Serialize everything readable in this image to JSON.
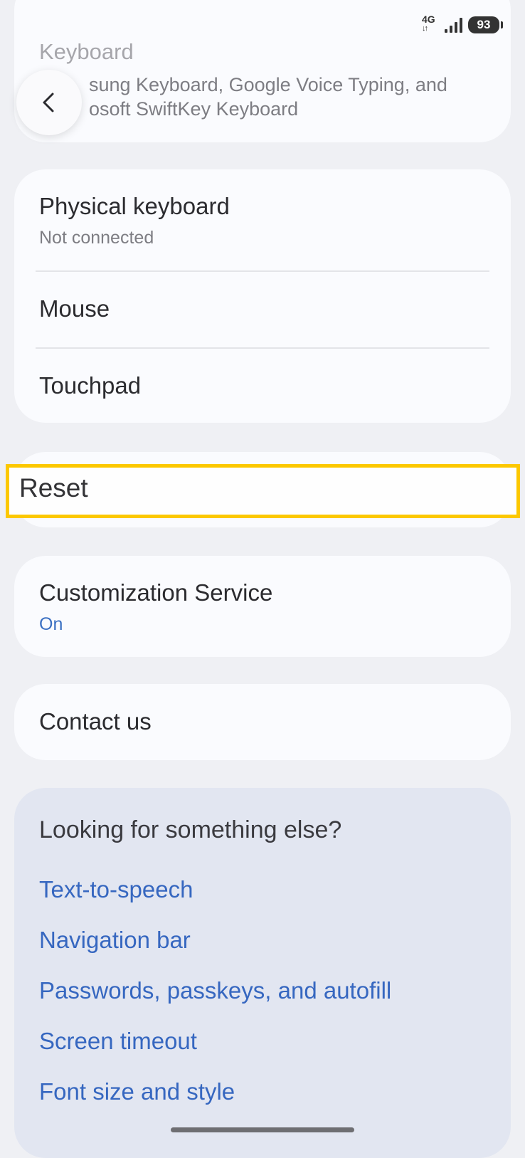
{
  "status_bar": {
    "network_type": "4G",
    "network_arrows": "↓↑",
    "battery_level": "93",
    "signal_icon": "signal-bars-icon",
    "battery_icon": "battery-icon"
  },
  "header": {
    "back_icon": "chevron-left-icon",
    "keyboard_title": "Keyboard",
    "keyboard_subtitle": "sung Keyboard, Google Voice Typing, and\nosoft SwiftKey Keyboard"
  },
  "devices": {
    "physical_keyboard": {
      "title": "Physical keyboard",
      "subtitle": "Not connected"
    },
    "mouse": {
      "title": "Mouse"
    },
    "touchpad": {
      "title": "Touchpad"
    }
  },
  "reset": {
    "title": "Reset"
  },
  "customization": {
    "title": "Customization Service",
    "status": "On"
  },
  "contact": {
    "title": "Contact us"
  },
  "looking_for": {
    "title": "Looking for something else?",
    "links": [
      "Text-to-speech",
      "Navigation bar",
      "Passwords, passkeys, and autofill",
      "Screen timeout",
      "Font size and style"
    ]
  },
  "colors": {
    "background": "#eff0f4",
    "card": "#fafbfe",
    "suggestion_card": "#e2e6f1",
    "link": "#3667c0",
    "highlight": "#fcc800"
  }
}
